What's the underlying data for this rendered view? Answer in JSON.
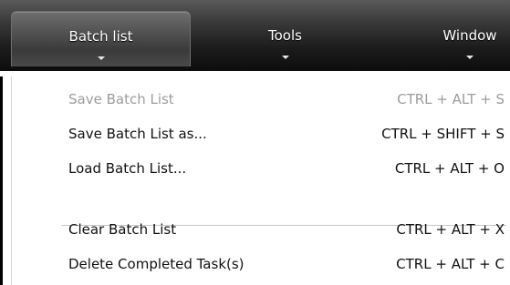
{
  "menubar": {
    "tabs": [
      {
        "label": "Batch list"
      },
      {
        "label": "Tools"
      },
      {
        "label": "Window"
      }
    ]
  },
  "dropdown": {
    "items": [
      {
        "label": "Save Batch List",
        "shortcut": "CTRL + ALT + S",
        "enabled": false
      },
      {
        "label": "Save Batch List as...",
        "shortcut": "CTRL + SHIFT + S",
        "enabled": true
      },
      {
        "label": "Load Batch List...",
        "shortcut": "CTRL + ALT + O",
        "enabled": true
      },
      {
        "label": "Clear Batch List",
        "shortcut": "CTRL + ALT + X",
        "enabled": true
      },
      {
        "label": "Delete Completed Task(s)",
        "shortcut": "CTRL + ALT + C",
        "enabled": true
      }
    ]
  }
}
